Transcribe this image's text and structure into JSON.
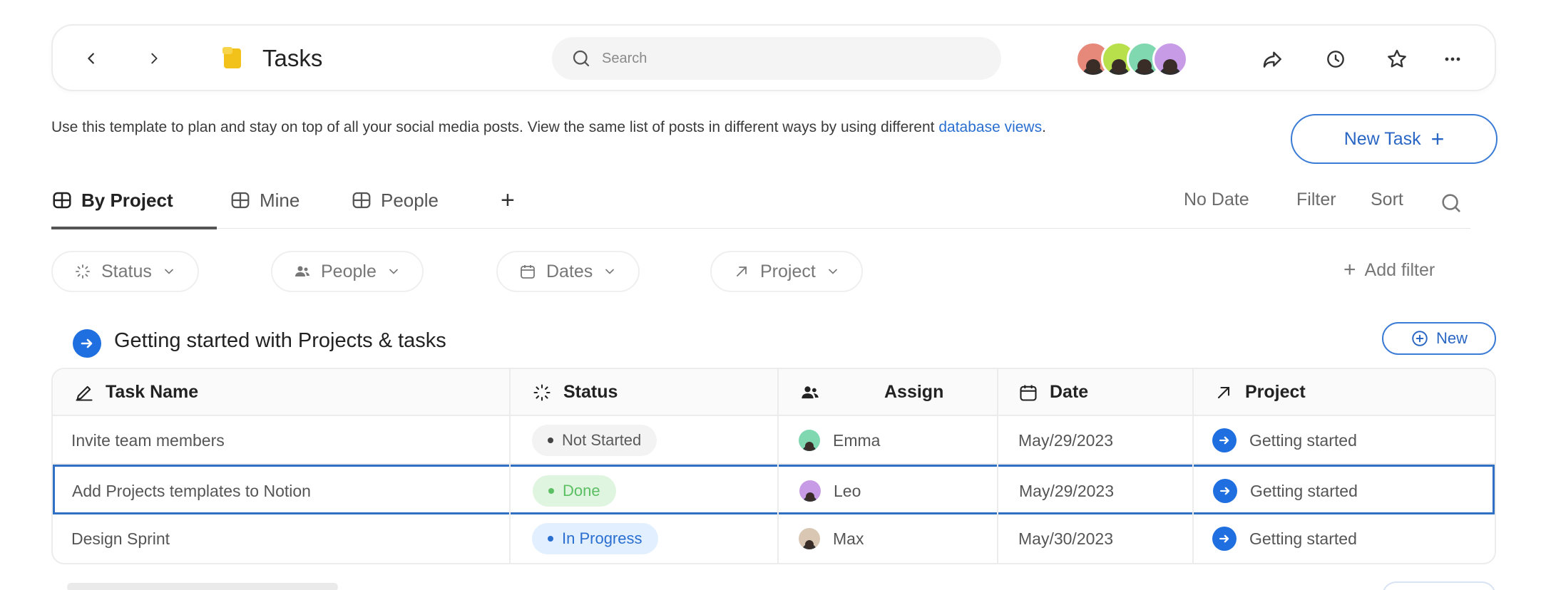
{
  "topbar": {
    "title": "Tasks",
    "search_placeholder": "Search",
    "avatars": [
      {
        "name": "avatar-1",
        "bg": "#e7897a"
      },
      {
        "name": "avatar-2",
        "bg": "#b8e04a"
      },
      {
        "name": "avatar-3",
        "bg": "#7fd8b0"
      },
      {
        "name": "avatar-4",
        "bg": "#c79be6"
      }
    ]
  },
  "description": {
    "text": "Use this template to plan and stay on top of all your social media posts. View the same list of posts in different ways by using different ",
    "link": "database views",
    "suffix": "."
  },
  "new_task_label": "New Task",
  "tabs": [
    {
      "label": "By Project",
      "active": true
    },
    {
      "label": "Mine",
      "active": false
    },
    {
      "label": "People",
      "active": false
    }
  ],
  "view_tools": {
    "no_date": "No Date",
    "filter": "Filter",
    "sort": "Sort"
  },
  "filters": {
    "status": "Status",
    "people": "People",
    "dates": "Dates",
    "project": "Project",
    "add_filter": "Add filter"
  },
  "group": {
    "title": "Getting started with Projects & tasks",
    "new_label": "New"
  },
  "table": {
    "headers": {
      "task": "Task Name",
      "status": "Status",
      "assign": "Assign",
      "date": "Date",
      "project": "Project"
    },
    "rows": [
      {
        "task": "Invite team members",
        "status": "Not Started",
        "assignee": "Emma",
        "date": "May/29/2023",
        "project": "Getting started"
      },
      {
        "task": "Add Projects templates to Notion",
        "status": "Done",
        "assignee": "Leo",
        "date": "May/29/2023",
        "project": "Getting started"
      },
      {
        "task": "Design Sprint",
        "status": "In Progress",
        "assignee": "Max",
        "date": "May/30/2023",
        "project": "Getting started"
      }
    ]
  },
  "colors": {
    "accent": "#1f6fe0",
    "done": "#5bbf63",
    "in_progress": "#2a6fd0"
  }
}
